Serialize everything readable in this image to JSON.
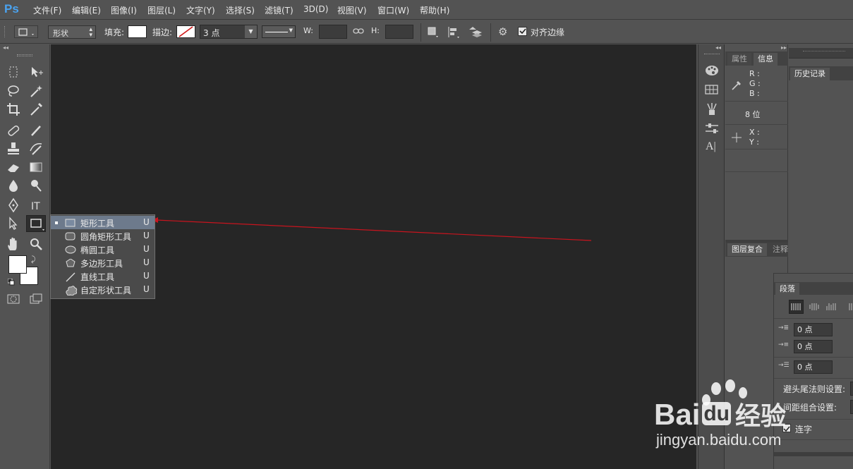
{
  "app": {
    "logo": "Ps"
  },
  "menu": [
    "文件(F)",
    "编辑(E)",
    "图像(I)",
    "图层(L)",
    "文字(Y)",
    "选择(S)",
    "滤镜(T)",
    "3D(D)",
    "视图(V)",
    "窗口(W)",
    "帮助(H)"
  ],
  "options": {
    "mode_value": "形状",
    "fill_label": "填充:",
    "stroke_label": "描边:",
    "stroke_width": "3 点",
    "w_label": "W:",
    "h_label": "H:",
    "align_edges_label": "对齐边缘",
    "align_edges_checked": true
  },
  "flyout": [
    {
      "name": "矩形工具",
      "shortcut": "U",
      "icon": "rectangle-icon",
      "selected": true
    },
    {
      "name": "圆角矩形工具",
      "shortcut": "U",
      "icon": "rounded-rectangle-icon",
      "selected": false
    },
    {
      "name": "椭圆工具",
      "shortcut": "U",
      "icon": "ellipse-icon",
      "selected": false
    },
    {
      "name": "多边形工具",
      "shortcut": "U",
      "icon": "polygon-icon",
      "selected": false
    },
    {
      "name": "直线工具",
      "shortcut": "U",
      "icon": "line-icon",
      "selected": false
    },
    {
      "name": "自定形状工具",
      "shortcut": "U",
      "icon": "custom-shape-icon",
      "selected": false
    }
  ],
  "info_panel": {
    "tabs": [
      "属性",
      "信息"
    ],
    "active_tab": "信息",
    "r_label": "R :",
    "g_label": "G :",
    "b_label": "B :",
    "bit_depth": "8 位",
    "x_label": "X :",
    "y_label": "Y :"
  },
  "history_panel": {
    "tab": "历史记录"
  },
  "layer_comps": {
    "tabs": [
      "图层复合",
      "注释"
    ]
  },
  "paragraph_panel": {
    "tab": "段落",
    "indent_left": "0 点",
    "indent_first": "0 点",
    "space_before": "0 点",
    "kinsoku_label": "避头尾法则设置:",
    "mojikumi_label": "间距组合设置:",
    "hyphenate_label": "连字",
    "hyphenate_checked": true
  },
  "watermark": {
    "brand": "Bai",
    "brand2": "du",
    "cn": "经验",
    "url": "jingyan.baidu.com"
  },
  "colors": {
    "accent_arrow": "#c8141e",
    "selection": "#6d7a8c",
    "canvas": "#262626"
  }
}
